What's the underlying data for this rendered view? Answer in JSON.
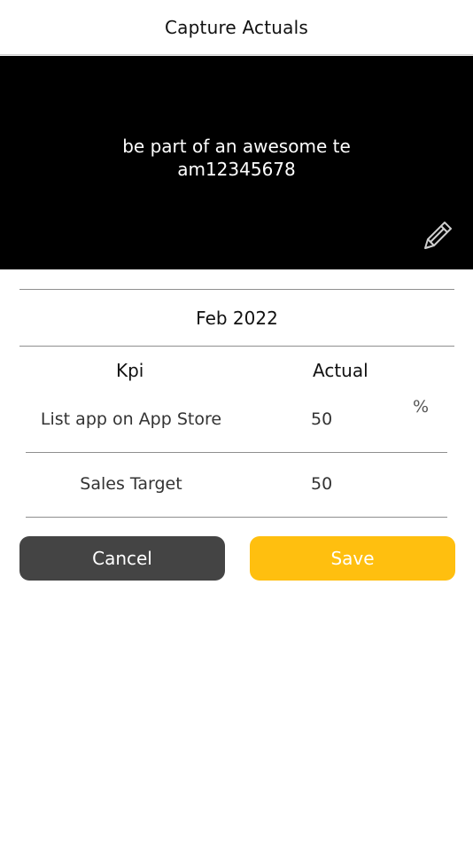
{
  "header": {
    "title": "Capture Actuals"
  },
  "banner": {
    "text": "be part of an awesome team12345678",
    "edit_icon": "pencil-icon"
  },
  "period": {
    "label": "Feb 2022"
  },
  "table": {
    "columns": [
      "Kpi",
      "Actual"
    ],
    "rows": [
      {
        "kpi": "List app on App Store",
        "actual": "50",
        "unit": "%"
      },
      {
        "kpi": "Sales Target",
        "actual": "50",
        "unit": ""
      }
    ]
  },
  "actions": {
    "cancel_label": "Cancel",
    "save_label": "Save"
  },
  "colors": {
    "accent": "#ffbf0f",
    "cancel": "#444444",
    "banner_bg": "#000000"
  }
}
